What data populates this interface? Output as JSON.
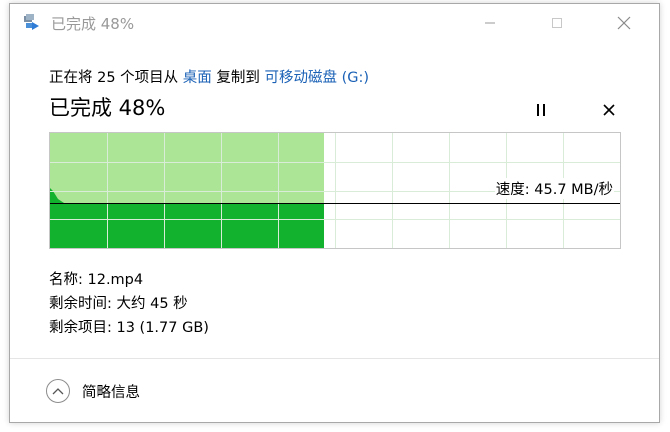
{
  "window": {
    "title": "已完成 48%",
    "app_icon": "file-copy-arrow-icon"
  },
  "operation": {
    "prefix": "正在将 25 个项目从 ",
    "source": "桌面",
    "middle": " 复制到 ",
    "destination": "可移动磁盘 (G:)"
  },
  "progress": {
    "status_text": "已完成 48%",
    "percent": 48
  },
  "speed": {
    "label": "速度: 45.7 MB/秒"
  },
  "details": {
    "name": "名称: 12.mp4",
    "time_remaining": "剩余时间: 大约 45 秒",
    "items_remaining": "剩余项目: 13 (1.77 GB)"
  },
  "footer": {
    "collapse_label": "简略信息"
  },
  "colors": {
    "accent_link": "#1a61b6",
    "progress_fill": "#a6e48f",
    "speed_fill": "#12b12e",
    "grid_line": "#d8ecd8"
  }
}
